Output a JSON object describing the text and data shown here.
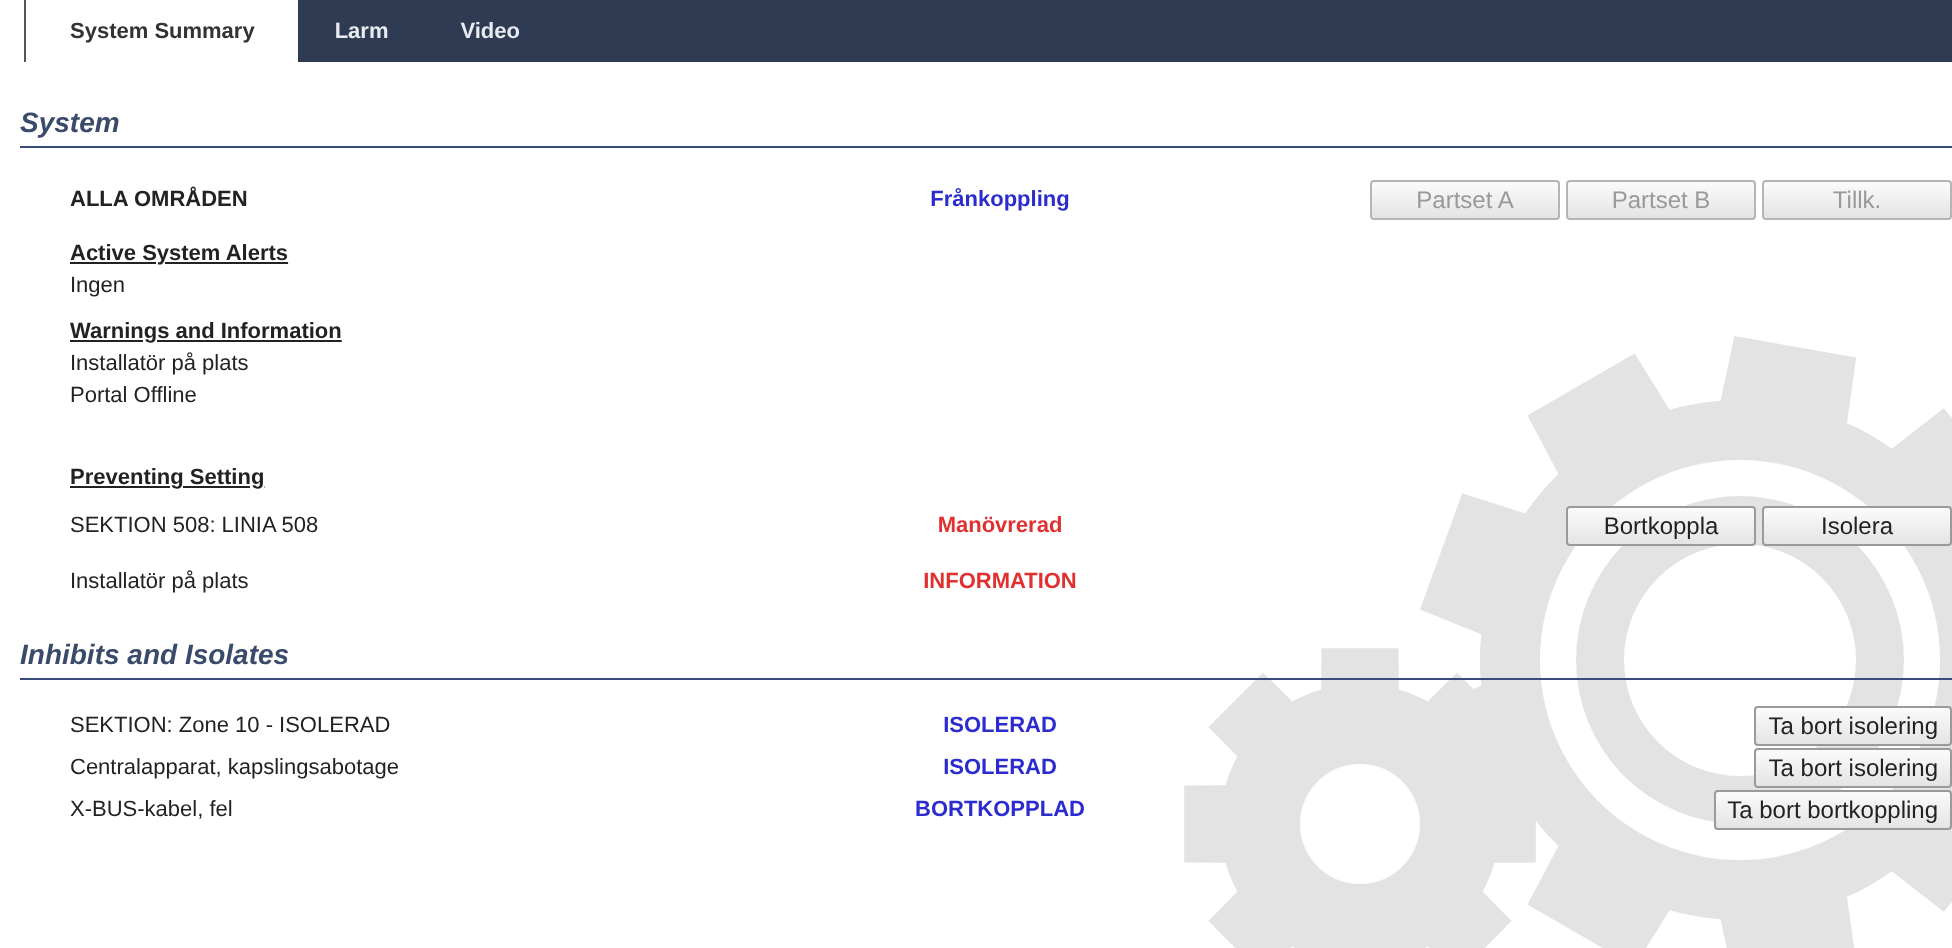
{
  "tabs": [
    {
      "label": "System Summary",
      "selected": true
    },
    {
      "label": "Larm",
      "selected": false
    },
    {
      "label": "Video",
      "selected": false
    }
  ],
  "system": {
    "title": "System",
    "area": {
      "label": "ALLA OMRÅDEN",
      "status": "Frånkoppling",
      "color": "#2b2bd0",
      "buttons": [
        {
          "label": "Partset A",
          "disabled": true
        },
        {
          "label": "Partset B",
          "disabled": true
        },
        {
          "label": "Tillk.",
          "disabled": true
        }
      ]
    },
    "groups": [
      {
        "heading": "Active System Alerts",
        "lines": [
          "Ingen"
        ]
      },
      {
        "heading": "Warnings and Information",
        "lines": [
          "Installatör på plats",
          "Portal Offline"
        ]
      }
    ],
    "preventing": {
      "heading": "Preventing Setting",
      "rows": [
        {
          "label": "SEKTION 508: LINIA 508",
          "status": "Manövrerad",
          "color": "#e03030",
          "buttons": [
            {
              "label": "Bortkoppla",
              "disabled": false
            },
            {
              "label": "Isolera",
              "disabled": false
            }
          ]
        },
        {
          "label": "Installatör på plats",
          "status": "INFORMATION",
          "color": "#e03030",
          "buttons": []
        }
      ]
    }
  },
  "inhibits": {
    "title": "Inhibits and Isolates",
    "rows": [
      {
        "label": "SEKTION: Zone 10 - ISOLERAD",
        "status": "ISOLERAD",
        "color": "#2b2bd0",
        "buttons": [
          {
            "label": "Ta bort isolering",
            "disabled": false
          }
        ]
      },
      {
        "label": "Centralapparat, kapslingsabotage",
        "status": "ISOLERAD",
        "color": "#2b2bd0",
        "buttons": [
          {
            "label": "Ta bort isolering",
            "disabled": false
          }
        ]
      },
      {
        "label": "X-BUS-kabel, fel",
        "status": "BORTKOPPLAD",
        "color": "#2b2bd0",
        "buttons": [
          {
            "label": "Ta bort bortkoppling",
            "disabled": false
          }
        ]
      }
    ]
  }
}
